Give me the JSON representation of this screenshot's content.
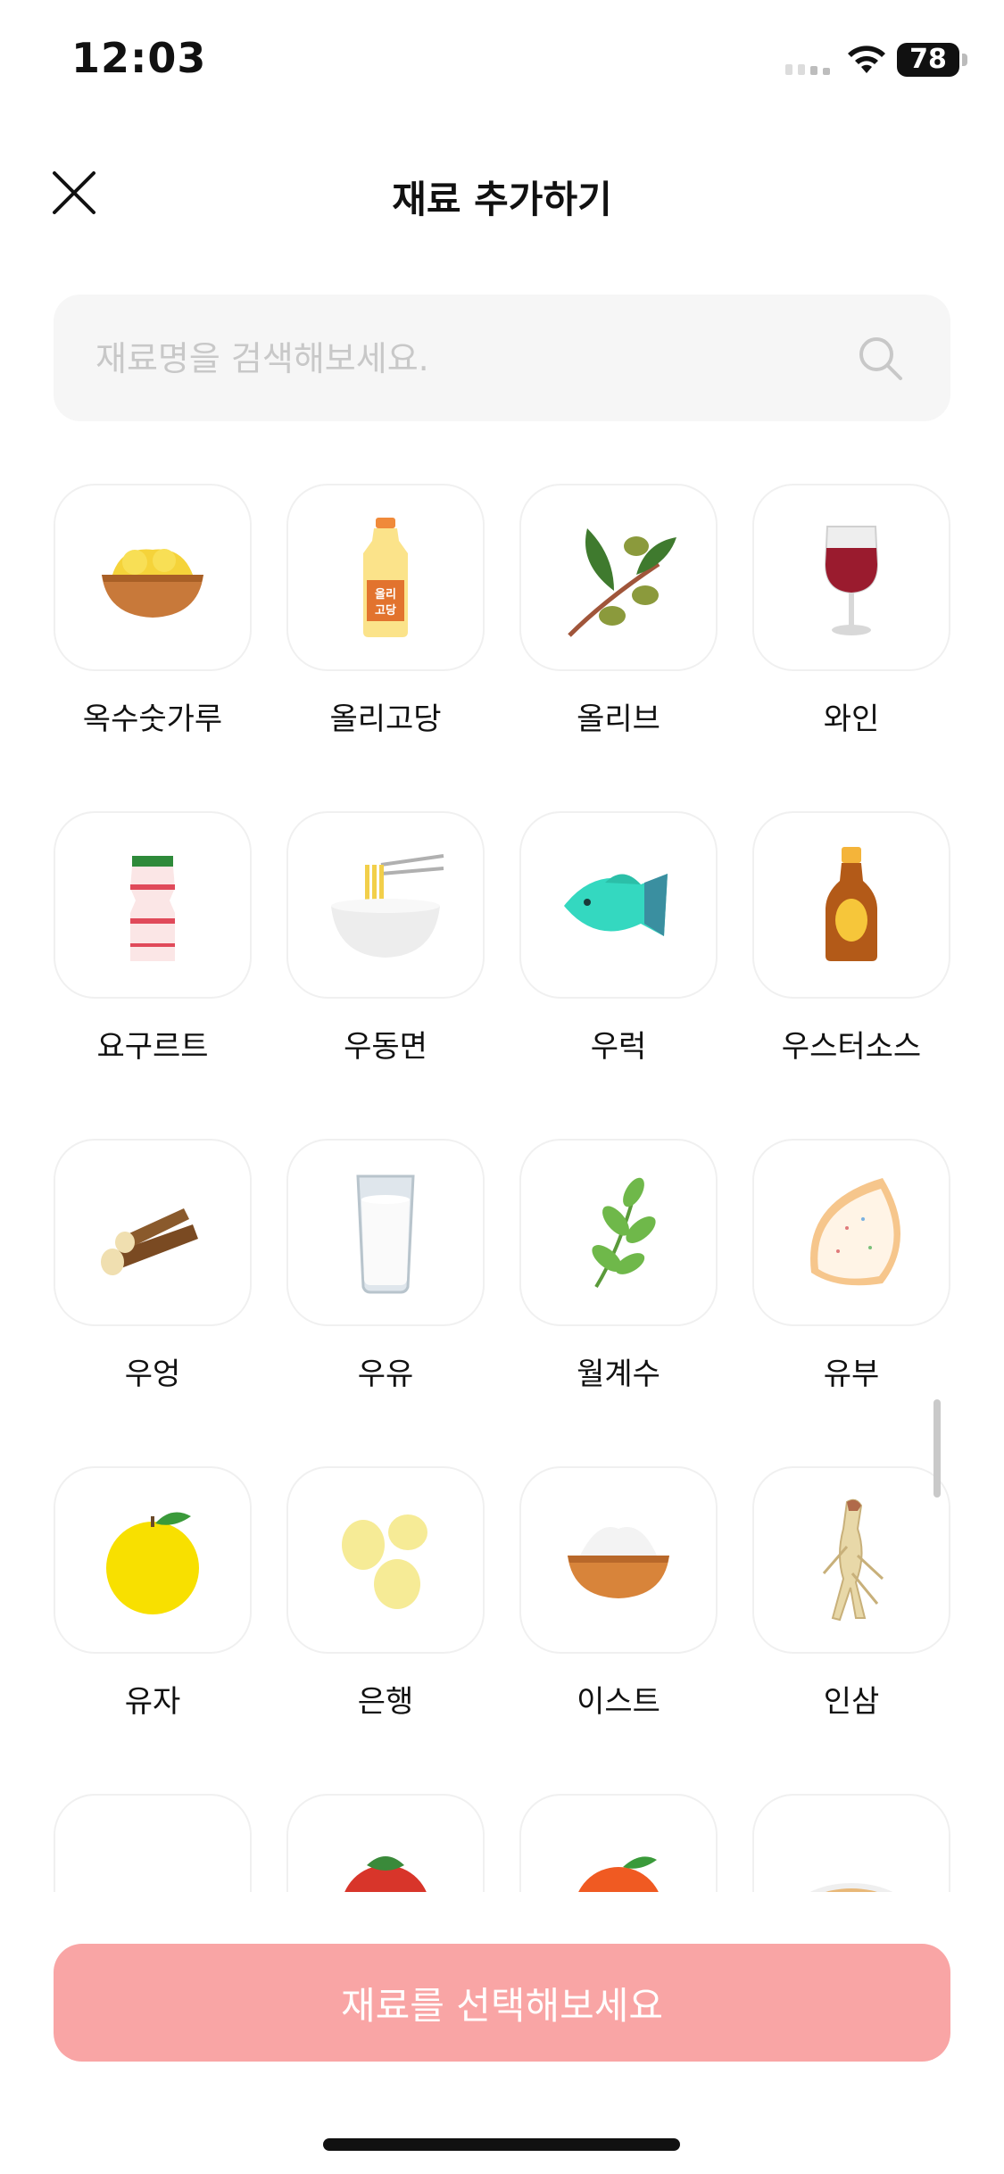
{
  "status_bar": {
    "time": "12:03",
    "battery": "78"
  },
  "header": {
    "title": "재료 추가하기"
  },
  "search": {
    "placeholder": "재료명을 검색해보세요."
  },
  "ingredients": [
    {
      "label": "옥수숫가루",
      "icon": "cornmeal-bowl-icon"
    },
    {
      "label": "올리고당",
      "icon": "oligosaccharide-bottle-icon",
      "bottle_text": "올리\n고당"
    },
    {
      "label": "올리브",
      "icon": "olive-branch-icon"
    },
    {
      "label": "와인",
      "icon": "wine-glass-icon"
    },
    {
      "label": "요구르트",
      "icon": "yogurt-bottle-icon"
    },
    {
      "label": "우동면",
      "icon": "udon-bowl-icon"
    },
    {
      "label": "우럭",
      "icon": "rockfish-icon"
    },
    {
      "label": "우스터소스",
      "icon": "worcestershire-sauce-icon"
    },
    {
      "label": "우엉",
      "icon": "burdock-root-icon"
    },
    {
      "label": "우유",
      "icon": "milk-glass-icon"
    },
    {
      "label": "월계수",
      "icon": "bay-leaf-icon"
    },
    {
      "label": "유부",
      "icon": "fried-tofu-icon"
    },
    {
      "label": "유자",
      "icon": "yuzu-icon"
    },
    {
      "label": "은행",
      "icon": "ginkgo-nut-icon"
    },
    {
      "label": "이스트",
      "icon": "yeast-bowl-icon"
    },
    {
      "label": "인삼",
      "icon": "ginseng-icon"
    },
    {
      "label": "",
      "icon": "powder-pile-icon"
    },
    {
      "label": "",
      "icon": "tomato-icon"
    },
    {
      "label": "",
      "icon": "orange-fruit-icon"
    },
    {
      "label": "",
      "icon": "noodle-plate-icon"
    }
  ],
  "cta": {
    "label": "재료를 선택해보세요"
  },
  "colors": {
    "cta_bg": "#f9a5a5",
    "tile_border": "#f0f0f0",
    "search_bg": "#f6f6f6"
  }
}
